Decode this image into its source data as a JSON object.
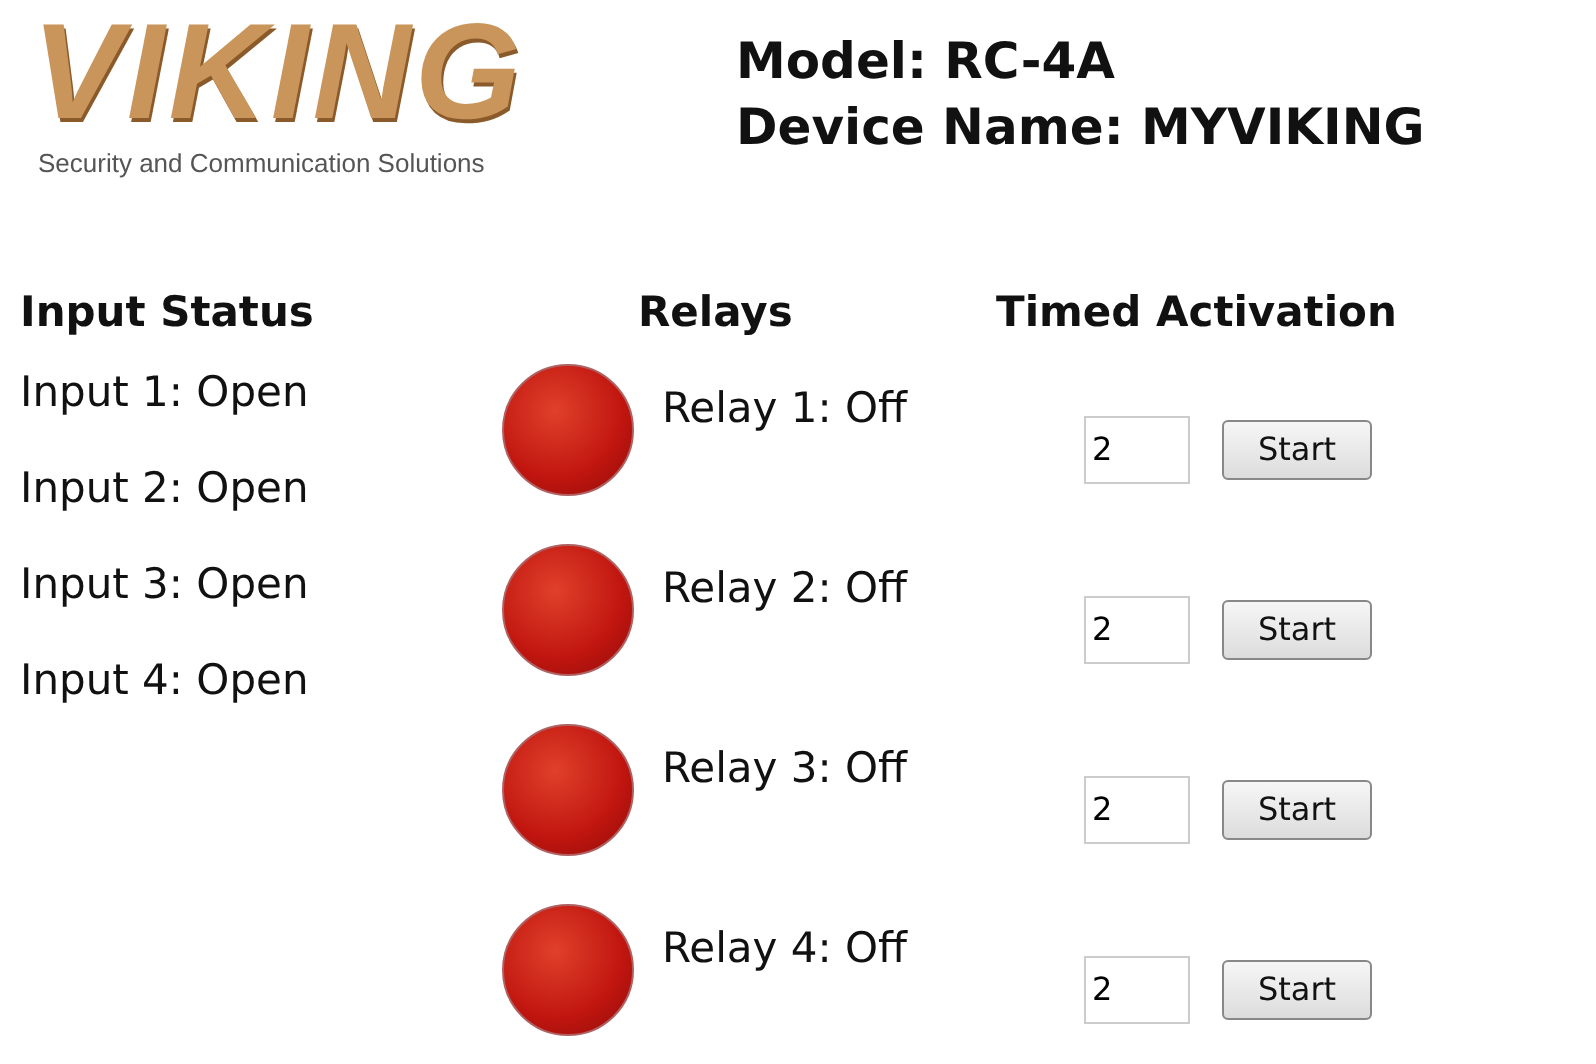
{
  "logo": {
    "name": "VIKING",
    "tagline": "Security and Communication Solutions"
  },
  "device": {
    "model": "Model: RC-4A",
    "name": "Device Name: MYVIKING"
  },
  "inputs": {
    "title": "Input Status",
    "items": [
      "Input 1: Open",
      "Input 2: Open",
      "Input 3: Open",
      "Input 4: Open"
    ]
  },
  "relays": {
    "title": "Relays",
    "items": [
      {
        "label": "Relay 1: Off",
        "on": false
      },
      {
        "label": "Relay 2: Off",
        "on": false
      },
      {
        "label": "Relay 3: Off",
        "on": false
      },
      {
        "label": "Relay 4: Off",
        "on": false
      }
    ]
  },
  "timed": {
    "title": "Timed Activation",
    "rows": [
      {
        "value": "2",
        "button": "Start"
      },
      {
        "value": "2",
        "button": "Start"
      },
      {
        "value": "2",
        "button": "Start"
      },
      {
        "value": "2",
        "button": "Start"
      }
    ]
  }
}
